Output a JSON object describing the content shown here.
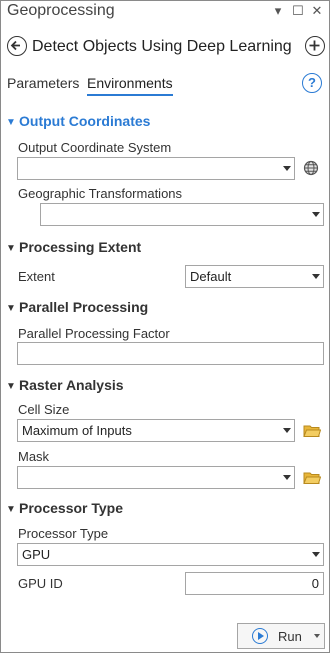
{
  "titlebar": {
    "title": "Geoprocessing",
    "pin_glyph": "▾",
    "restore_glyph": "☐",
    "close_glyph": "✕"
  },
  "tool": {
    "name": "Detect Objects Using Deep Learning"
  },
  "tabs": [
    {
      "label": "Parameters",
      "active": false
    },
    {
      "label": "Environments",
      "active": true
    }
  ],
  "help_glyph": "?",
  "sections": {
    "output_coordinates": {
      "title": "Output Coordinates",
      "output_coordinate_system": {
        "label": "Output Coordinate System",
        "value": ""
      },
      "geographic_transformations": {
        "label": "Geographic Transformations",
        "value": ""
      }
    },
    "processing_extent": {
      "title": "Processing Extent",
      "extent": {
        "label": "Extent",
        "value": "Default"
      }
    },
    "parallel_processing": {
      "title": "Parallel Processing",
      "factor": {
        "label": "Parallel Processing Factor",
        "value": ""
      }
    },
    "raster_analysis": {
      "title": "Raster Analysis",
      "cell_size": {
        "label": "Cell Size",
        "value": "Maximum of Inputs"
      },
      "mask": {
        "label": "Mask",
        "value": ""
      }
    },
    "processor_type": {
      "title": "Processor Type",
      "processor_type": {
        "label": "Processor Type",
        "value": "GPU"
      },
      "gpu_id": {
        "label": "GPU ID",
        "value": "0"
      }
    }
  },
  "run_button": {
    "label": "Run"
  },
  "colors": {
    "accent": "#2b7bd4",
    "folder": "#e8b63a",
    "border": "#a5a5a5"
  }
}
